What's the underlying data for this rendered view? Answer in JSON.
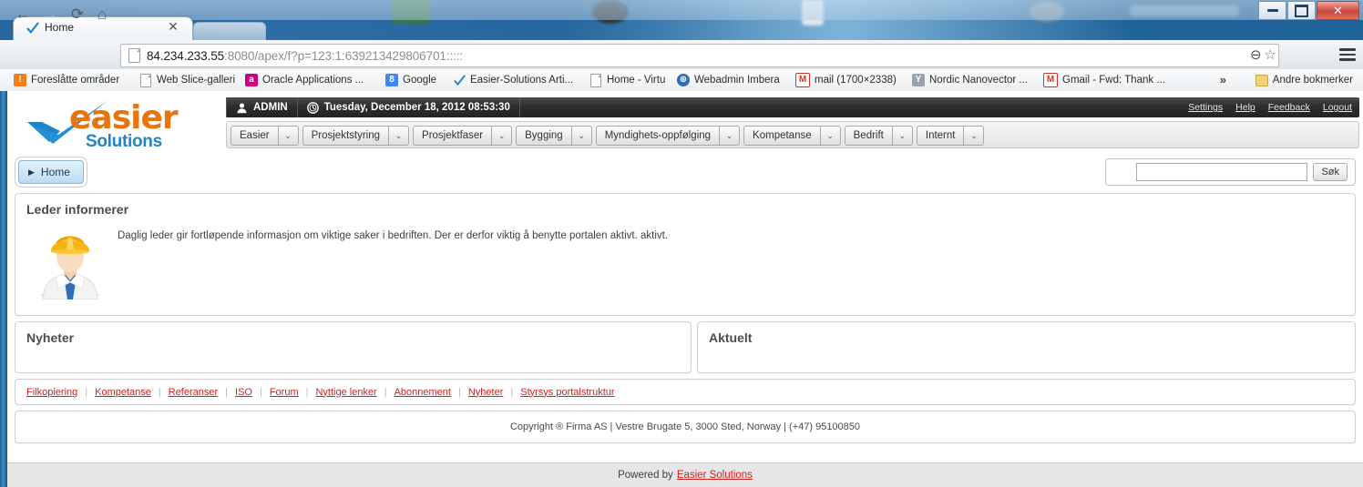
{
  "window": {
    "buttons": [
      {
        "name": "minimize",
        "glyph": "▬"
      },
      {
        "name": "maximize",
        "glyph": "❐"
      },
      {
        "name": "close",
        "glyph": "✕"
      }
    ]
  },
  "browser": {
    "tab_title": "Home",
    "tab_close_glyph": "✕",
    "back_glyph": "←",
    "forward_glyph": "→",
    "reload_glyph": "⟳",
    "home_glyph": "⌂",
    "url_scheme_host": "84.234.233.55",
    "url_rest": ":8080/apex/f?p=123:1:639213429806701:::::",
    "zoom_glyph": "⊖",
    "star_glyph": "☆",
    "overflow_glyph": "»",
    "bookmarks": [
      {
        "label": "Foreslåtte områder",
        "icon": "lightbulb-icon"
      },
      {
        "label": "Web Slice-galleri",
        "icon": "document-icon"
      },
      {
        "label": "Oracle Applications ...",
        "icon": "oracle-icon"
      },
      {
        "label": "Google",
        "icon": "google-icon"
      },
      {
        "label": "Easier-Solutions Arti...",
        "icon": "checkmark-icon"
      },
      {
        "label": "Home - Virtu",
        "icon": "document-icon"
      },
      {
        "label": "Webadmin Imbera",
        "icon": "globe-icon"
      },
      {
        "label": "mail (1700×2338)",
        "icon": "gmail-icon"
      },
      {
        "label": "Nordic Nanovector ...",
        "icon": "nordic-icon"
      },
      {
        "label": "Gmail - Fwd: Thank ...",
        "icon": "gmail-icon"
      }
    ],
    "other_bookmarks": "Andre bokmerker"
  },
  "app": {
    "logo": {
      "primary": "easier",
      "secondary": "Solutions"
    },
    "user": "ADMIN",
    "user_icon": "person-icon",
    "clock_icon": "clock-icon",
    "datetime": "Tuesday, December 18, 2012 08:53:30",
    "account_links": [
      "Settings",
      "Help",
      "Feedback",
      "Logout"
    ],
    "menu": [
      {
        "label": "Easier"
      },
      {
        "label": "Prosjektstyring"
      },
      {
        "label": "Prosjektfaser"
      },
      {
        "label": "Bygging"
      },
      {
        "label": "Myndighets-oppfølging"
      },
      {
        "label": "Kompetanse"
      },
      {
        "label": "Bedrift"
      },
      {
        "label": "Internt"
      }
    ],
    "menu_arrow_glyph": "⌄",
    "breadcrumb": {
      "label": "Home",
      "arrow_glyph": "▶"
    },
    "search": {
      "value": "",
      "placeholder": "",
      "button_label": "Søk"
    }
  },
  "regions": {
    "leder": {
      "title": "Leder informerer",
      "avatar_icon": "worker-avatar-icon",
      "body": "Daglig leder gir fortløpende informasjon om viktige saker i bedriften. Der er derfor viktig å benytte portalen aktivt. aktivt."
    },
    "nyheter": {
      "title": "Nyheter"
    },
    "aktuelt": {
      "title": "Aktuelt"
    }
  },
  "footer": {
    "links": [
      "Filkopiering",
      "Kompetanse",
      "Referanser",
      "ISO",
      "Forum",
      "Nyttige lenker",
      "Abonnement",
      "Nyheter",
      "Styrsys portalstruktur"
    ],
    "separator": "|",
    "copyright": "Copyright ® Firma AS | Vestre Brugate 5, 3000 Sted, Norway | (+47) 95100850",
    "powered_prefix": "Powered by",
    "powered_link": "Easier Solutions"
  },
  "colors": {
    "brand_orange": "#e8740d",
    "brand_blue": "#1f84c8",
    "link_red": "#d01e1e",
    "header_dark": "#2d2d2d"
  }
}
